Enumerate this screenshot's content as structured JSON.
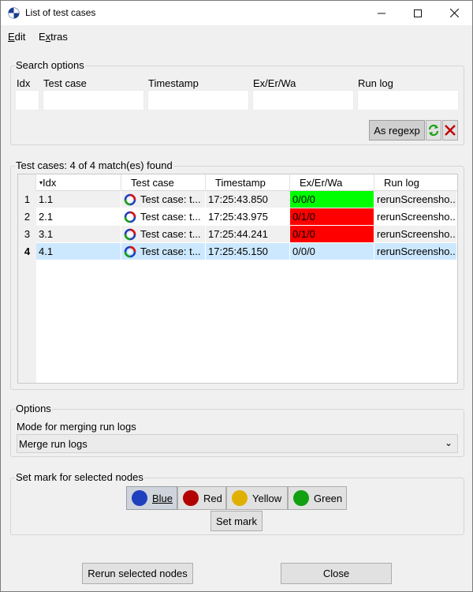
{
  "window": {
    "title": "List of test cases",
    "controls": {
      "minimize": "—",
      "maximize": "☐",
      "close": "✕"
    }
  },
  "menu": {
    "edit": "Edit",
    "edit_mnemonic": "E",
    "edit_rest": "dit",
    "extras_pre": "E",
    "extras_mnemonic": "x",
    "extras_rest": "tras"
  },
  "search": {
    "group_label": "Search options",
    "labels": {
      "idx": "Idx",
      "test_case": "Test case",
      "timestamp": "Timestamp",
      "exerwa": "Ex/Er/Wa",
      "run_log": "Run log"
    },
    "values": {
      "idx": "",
      "test_case": "",
      "timestamp": "",
      "exerwa": "",
      "run_log": ""
    },
    "regexp_button": "As regexp",
    "refresh_icon": "refresh-icon",
    "clear_icon": "clear-icon"
  },
  "results": {
    "group_label": "Test cases: 4 of 4 match(es) found",
    "columns": [
      "Idx",
      "Test case",
      "Timestamp",
      "Ex/Er/Wa",
      "Run log"
    ],
    "rows": [
      {
        "num": "1",
        "idx": "1.1",
        "test_case": "Test case: t...",
        "timestamp": "17:25:43.850",
        "exerwa": "0/0/0",
        "status_color": "#00ff00",
        "run_log": "rerunScreensho..."
      },
      {
        "num": "2",
        "idx": "2.1",
        "test_case": "Test case: t...",
        "timestamp": "17:25:43.975",
        "exerwa": "0/1/0",
        "status_color": "#ff0000",
        "run_log": "rerunScreensho..."
      },
      {
        "num": "3",
        "idx": "3.1",
        "test_case": "Test case: t...",
        "timestamp": "17:25:44.241",
        "exerwa": "0/1/0",
        "status_color": "#ff0000",
        "run_log": "rerunScreensho..."
      },
      {
        "num": "4",
        "idx": "4.1",
        "test_case": "Test case: t...",
        "timestamp": "17:25:45.150",
        "exerwa": "0/0/0",
        "status_color": "",
        "run_log": "rerunScreensho..."
      }
    ],
    "selected_row": 3,
    "selected_color": "#cce8ff"
  },
  "options": {
    "group_label": "Options",
    "merge_label": "Mode for merging run logs",
    "merge_value": "Merge run logs"
  },
  "marks": {
    "group_label": "Set mark for selected nodes",
    "buttons": [
      {
        "label": "Blue",
        "color": "#1f3fbf"
      },
      {
        "label": "Red",
        "color": "#b30000"
      },
      {
        "label": "Yellow",
        "color": "#e0b000"
      },
      {
        "label": "Green",
        "color": "#10a010"
      }
    ],
    "set_mark": "Set mark"
  },
  "footer": {
    "rerun": "Rerun selected nodes",
    "close": "Close"
  },
  "colors": {
    "accent_selected": "#cce8ff",
    "ok": "#00ff00",
    "error": "#ff0000"
  }
}
